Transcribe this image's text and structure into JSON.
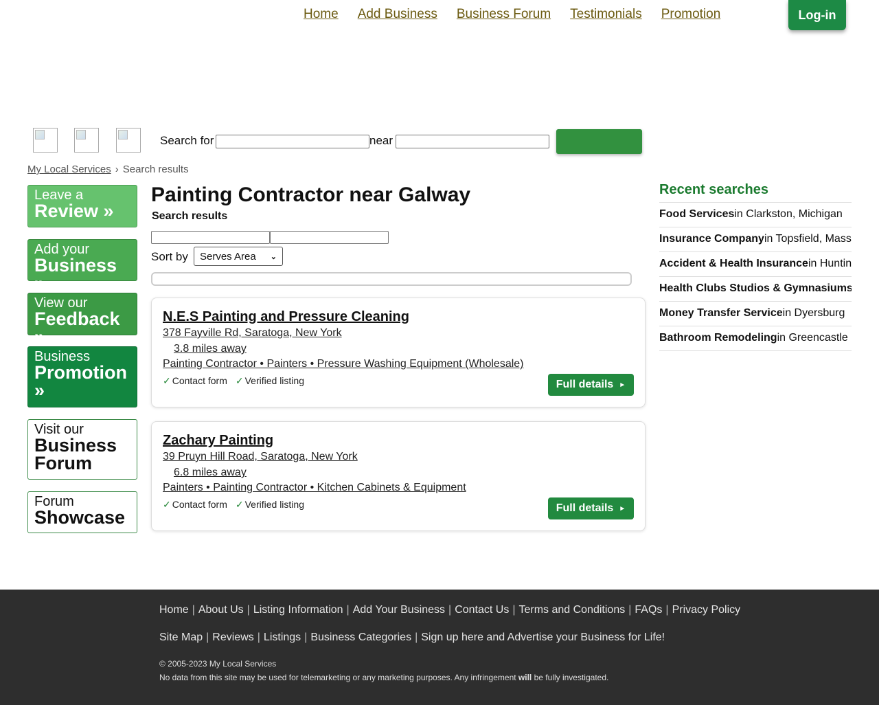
{
  "nav": {
    "items": [
      "Home",
      "Add Business",
      "Business Forum",
      "Testimonials",
      "Promotion"
    ],
    "login": "Log-in"
  },
  "search": {
    "search_for_label": "Search for",
    "near_label": "near",
    "search_for_value": "",
    "near_value": ""
  },
  "breadcrumb": {
    "home": "My Local Services",
    "sep": "›",
    "current": "Search results"
  },
  "sidebar": {
    "review": {
      "small": "Leave a",
      "big": "Review »"
    },
    "business": {
      "small": "Add your",
      "big": "Business »"
    },
    "feedback": {
      "small": "View our",
      "big": "Feedback »"
    },
    "promotion": {
      "small": "Business",
      "big": "Promotion »"
    },
    "forum": {
      "small": "Visit our",
      "big": "Business Forum"
    },
    "showcase": {
      "small": "Forum",
      "big": "Showcase"
    }
  },
  "main": {
    "title": "Painting Contractor near Galway",
    "subtitle": "Search results",
    "sort_label": "Sort by",
    "sort_selected": "Serves Area"
  },
  "listings": [
    {
      "name": "N.E.S Painting and Pressure Cleaning",
      "address": "378 Fayville Rd, Saratoga, New York",
      "distance": "3.8 miles away",
      "categories": "Painting Contractor • Painters • Pressure Washing Equipment (Wholesale)",
      "features": [
        "Contact form",
        "Verified listing"
      ],
      "button": "Full details"
    },
    {
      "name": "Zachary Painting",
      "address": "39 Pruyn Hill Road, Saratoga, New York",
      "distance": "6.8 miles away",
      "categories": "Painters • Painting Contractor • Kitchen Cabinets & Equipment",
      "features": [
        "Contact form",
        "Verified listing"
      ],
      "button": "Full details"
    }
  ],
  "recent": {
    "heading": "Recent searches",
    "items": [
      {
        "term": "Food Services",
        "place": "in Clarkston, Michigan"
      },
      {
        "term": "Insurance Company",
        "place": "in Topsfield, Massachusetts"
      },
      {
        "term": "Accident & Health Insurance",
        "place": "in Huntington"
      },
      {
        "term": "Health Clubs Studios & Gymnasiums",
        "place": ""
      },
      {
        "term": "Money Transfer Service",
        "place": "in Dyersburg"
      },
      {
        "term": "Bathroom Remodeling",
        "place": "in Greencastle"
      }
    ]
  },
  "footer": {
    "row1": [
      "Home",
      "About Us",
      "Listing Information",
      "Add Your Business",
      "Contact Us",
      "Terms and Conditions",
      "FAQs",
      "Privacy Policy"
    ],
    "row2": [
      "Site Map",
      "Reviews",
      "Listings",
      "Business Categories",
      "Sign up here and Advertise your Business for Life!"
    ],
    "copyright": "© 2005-2023 My Local Services",
    "disclaimer_pre": "No data from this site may be used for telemarketing or any marketing purposes. Any infringement ",
    "disclaimer_bold": "will",
    "disclaimer_post": " be fully investigated."
  }
}
